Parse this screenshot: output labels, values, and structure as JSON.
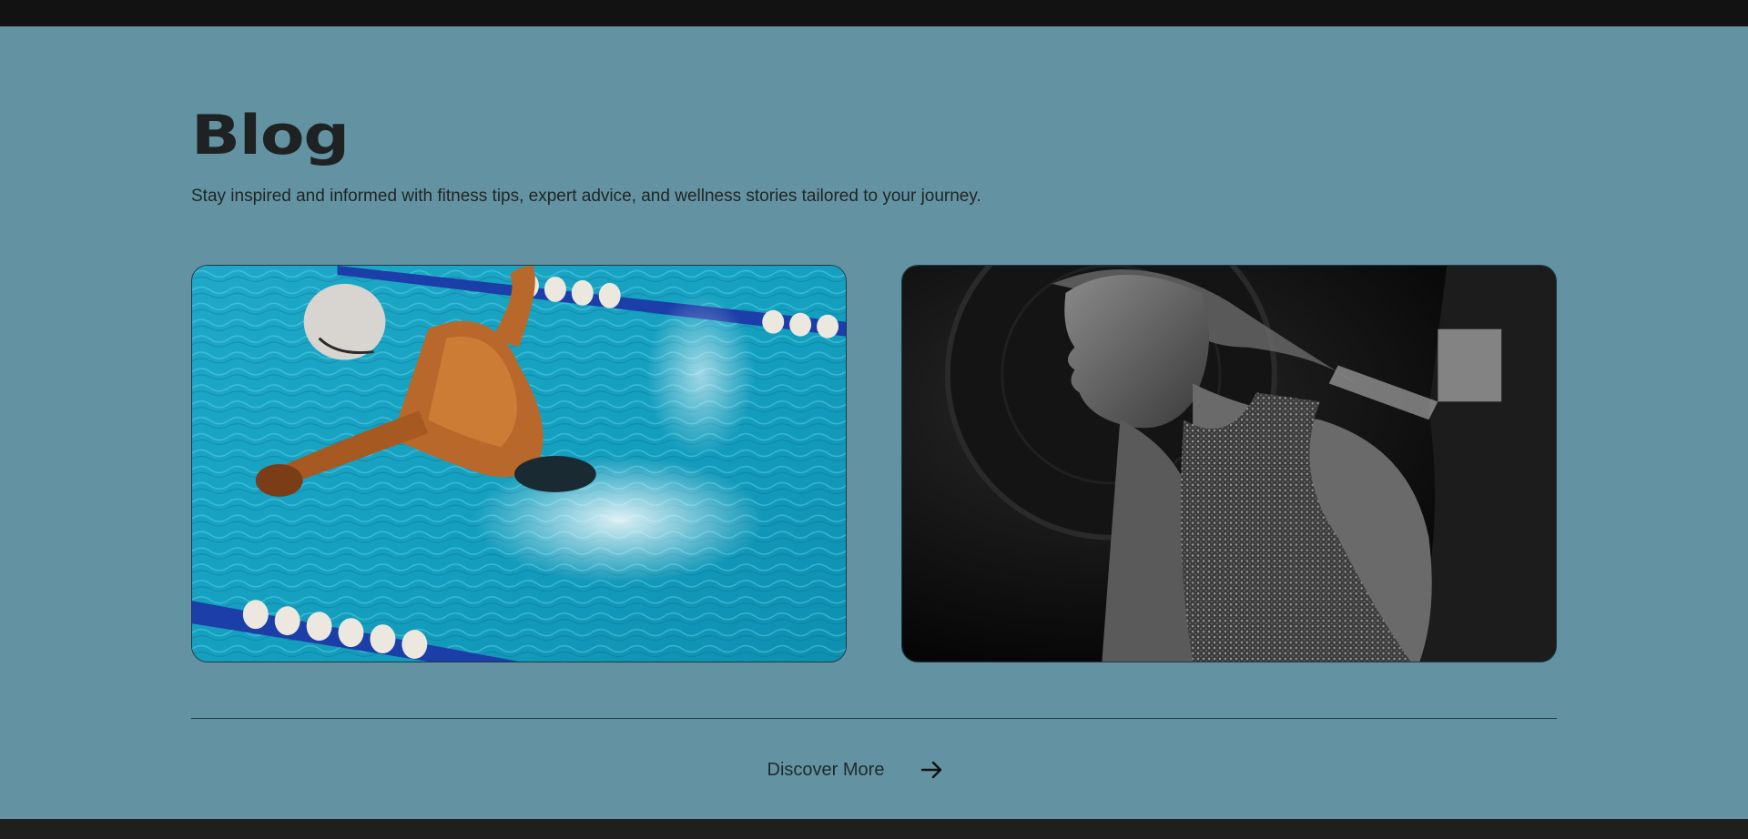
{
  "blog": {
    "title": "Blog",
    "subtitle": "Stay inspired and informed with fitness tips, expert advice, and wellness stories tailored to your journey."
  },
  "cards": [
    {
      "image": "swimmer-butterfly-photo"
    },
    {
      "image": "woman-gym-portrait-photo"
    }
  ],
  "discover": {
    "label": "Discover More",
    "icon": "arrow-right-icon"
  },
  "colors": {
    "section_bg": "#6393a2",
    "top_bar": "#121212",
    "bottom_bar": "#1f1f1f",
    "text_dark": "#1f2222",
    "divider": "#1d3d48"
  }
}
